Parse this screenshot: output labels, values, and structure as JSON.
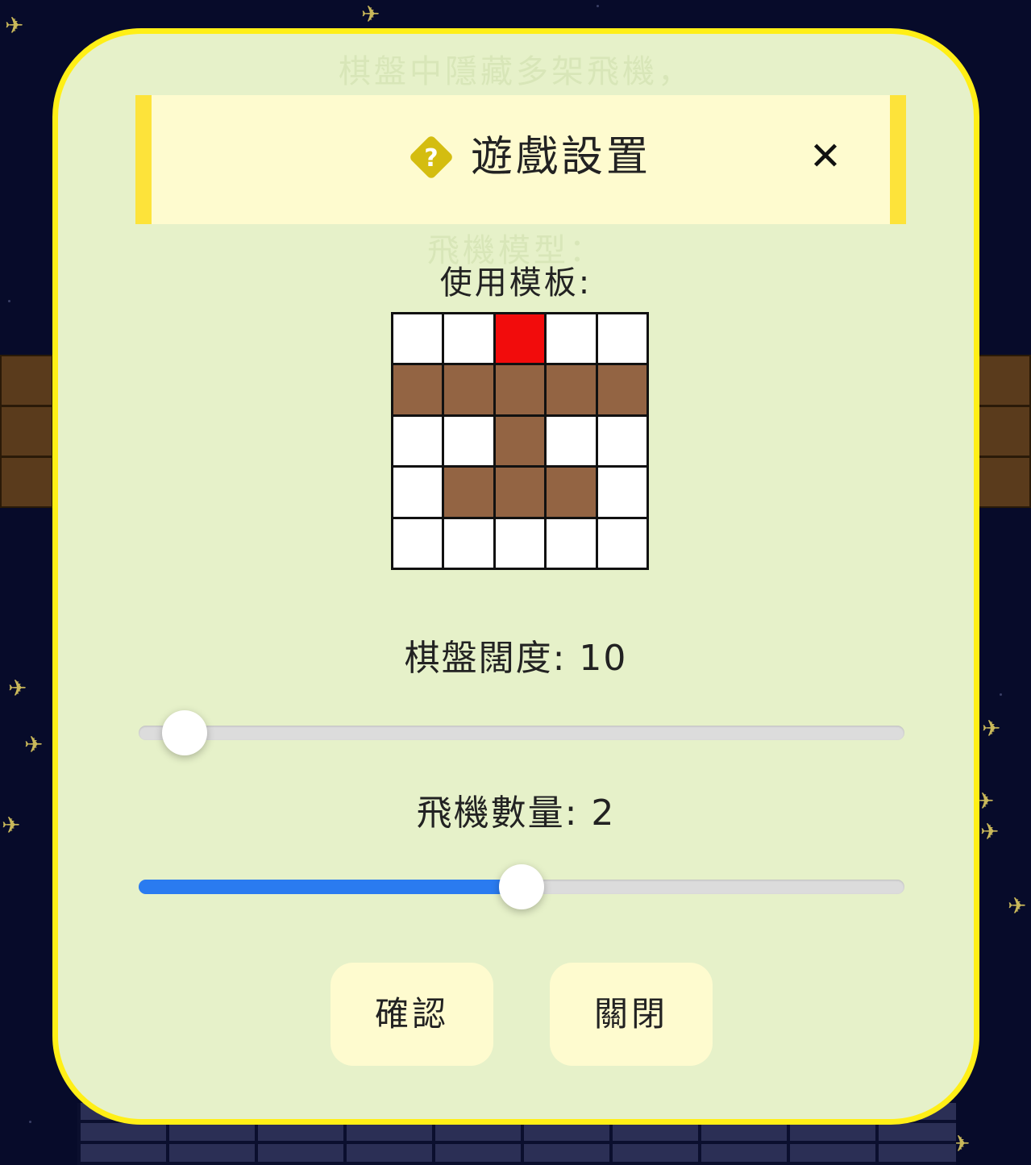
{
  "modal": {
    "title": "遊戲設置",
    "close_glyph": "✕",
    "background_text_top": "棋盤中隱藏多架飛機，",
    "background_text_mid": "飛機模型："
  },
  "template": {
    "label": "使用模板:",
    "grid": [
      [
        "empty",
        "empty",
        "head",
        "empty",
        "empty"
      ],
      [
        "body",
        "body",
        "body",
        "body",
        "body"
      ],
      [
        "empty",
        "empty",
        "body",
        "empty",
        "empty"
      ],
      [
        "empty",
        "body",
        "body",
        "body",
        "empty"
      ],
      [
        "empty",
        "empty",
        "empty",
        "empty",
        "empty"
      ]
    ],
    "colors": {
      "empty": "#ffffff",
      "body": "#936443",
      "head": "#f20c0c"
    }
  },
  "board_width": {
    "label": "棋盤闊度: 10",
    "value": 10,
    "fill_fraction": 0.06
  },
  "plane_count": {
    "label": "飛機數量: 2",
    "value": 2,
    "fill_fraction": 0.5
  },
  "buttons": {
    "confirm": "確認",
    "close": "關閉"
  },
  "colors": {
    "modal_bg": "#e6f1c9",
    "modal_border": "#ffef16",
    "header_bg": "#fefbcf",
    "accent_blue": "#2a7bf0",
    "page_bg": "#070b2a"
  }
}
